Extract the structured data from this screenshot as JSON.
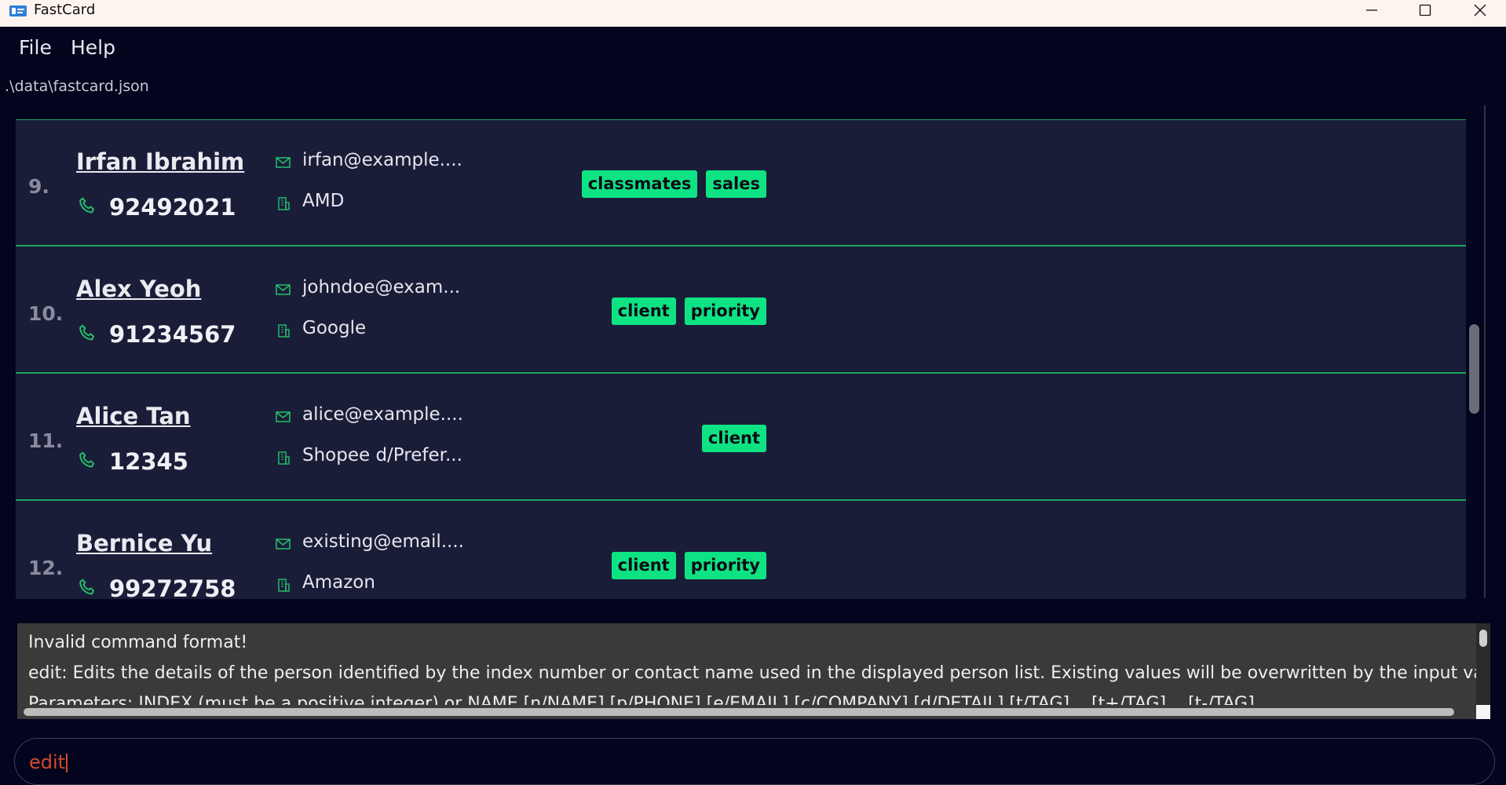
{
  "window": {
    "title": "FastCard"
  },
  "menu": {
    "file": "File",
    "help": "Help"
  },
  "file_path": ".\\data\\fastcard.json",
  "persons": [
    {
      "index": "9.",
      "name": "Irfan Ibrahim",
      "phone": "92492021",
      "email": "irfan@example....",
      "company": "AMD",
      "tags": [
        "classmates",
        "sales"
      ]
    },
    {
      "index": "10.",
      "name": "Alex Yeoh",
      "phone": "91234567",
      "email": "johndoe@exam...",
      "company": "Google",
      "tags": [
        "client",
        "priority"
      ]
    },
    {
      "index": "11.",
      "name": "Alice Tan",
      "phone": "12345",
      "email": "alice@example....",
      "company": "Shopee d/Prefer...",
      "tags": [
        "client"
      ]
    },
    {
      "index": "12.",
      "name": "Bernice Yu",
      "phone": "99272758",
      "email": "existing@email....",
      "company": "Amazon",
      "tags": [
        "client",
        "priority"
      ]
    }
  ],
  "result": {
    "line1": "Invalid command format!",
    "line2": "edit: Edits the details of the person identified by the index number or contact name used in the displayed person list. Existing values will be overwritten by the input values",
    "line3": "Parameters: INDEX (must be a positive integer) or NAME [n/NAME] [p/PHONE] [e/EMAIL] [c/COMPANY] [d/DETAIL] [t/TAG]... [t+/TAG]... [t-/TAG]..."
  },
  "command": {
    "value": "edit"
  },
  "colors": {
    "background": "#02051d",
    "card": "#1a1d38",
    "accent": "#0ee384",
    "divider": "#18a85a",
    "command_text": "#d24a2e"
  },
  "icons": {
    "phone": "phone-icon",
    "email": "mail-icon",
    "company": "building-icon"
  }
}
